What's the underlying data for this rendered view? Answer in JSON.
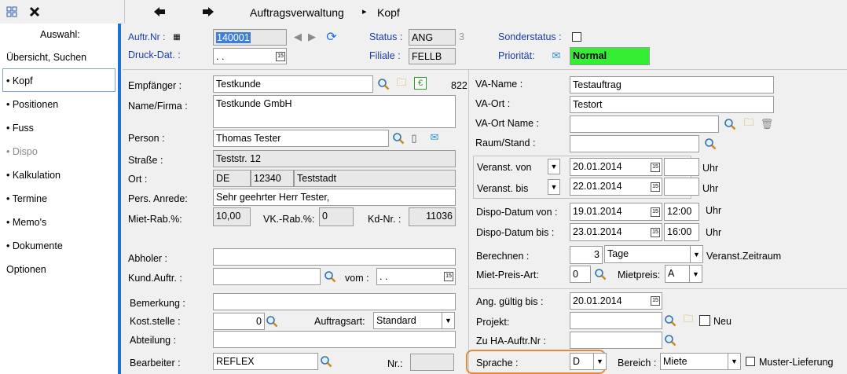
{
  "toolbar": {
    "grid_icon": "grid-icon",
    "close_icon": "close-icon",
    "back_icon": "arrow-left-icon",
    "forward_icon": "arrow-right-icon",
    "breadcrumb_root": "Auftragsverwaltung",
    "breadcrumb_sep": "▸",
    "breadcrumb_leaf": "Kopf"
  },
  "sidebar": {
    "title": "Auswahl:",
    "items": [
      {
        "label": "Übersicht, Suchen"
      },
      {
        "label": "• Kopf"
      },
      {
        "label": "• Positionen"
      },
      {
        "label": "• Fuss"
      },
      {
        "label": "• Dispo"
      },
      {
        "label": "• Kalkulation"
      },
      {
        "label": "• Termine"
      },
      {
        "label": "• Memo's"
      },
      {
        "label": "• Dokumente"
      },
      {
        "label": "Optionen"
      }
    ]
  },
  "header": {
    "auftr_nr_label": "Auftr.Nr :",
    "auftr_nr": "140001",
    "status_label": "Status :",
    "status": "ANG",
    "status_num": "3",
    "sonderstatus_label": "Sonderstatus :",
    "druck_dat_label": "Druck-Dat. :",
    "druck_dat": " .  .",
    "filiale_label": "Filiale :",
    "filiale": "FELLB",
    "prioritaet_label": "Priorität:",
    "prioritaet": "Normal"
  },
  "left": {
    "empfaenger_label": "Empfänger :",
    "empfaenger": "Testkunde",
    "empfaenger_num": "822",
    "name_label": "Name/Firma :",
    "name": "Testkunde GmbH",
    "person_label": "Person :",
    "person": "Thomas Tester",
    "strasse_label": "Straße :",
    "strasse": "Teststr. 12",
    "ort_label": "Ort :",
    "land": "DE",
    "plz": "12340",
    "ort": "Teststadt",
    "anrede_label": "Pers. Anrede:",
    "anrede": "Sehr geehrter Herr Tester,",
    "mietrab_label": "Miet-Rab.%:",
    "mietrab": "10,00",
    "vkrab_label": "VK.-Rab.%:",
    "vkrab": "0",
    "kdnr_label": "Kd-Nr. :",
    "kdnr": "11036",
    "abholer_label": "Abholer :",
    "abholer": "",
    "kundauftr_label": "Kund.Auftr. :",
    "kundauftr": "",
    "vom_label": "vom :",
    "vom": " .  .",
    "bemerkung_label": "Bemerkung :",
    "bemerkung": "",
    "koststelle_label": "Kost.stelle :",
    "koststelle": "0",
    "auftragsart_label": "Auftragsart:",
    "auftragsart": "Standard",
    "abteilung_label": "Abteilung :",
    "abteilung": "",
    "bearbeiter_label": "Bearbeiter :",
    "bearbeiter": "REFLEX",
    "nr_label": "Nr.:",
    "nr": ""
  },
  "right": {
    "vaname_label": "VA-Name :",
    "vaname": "Testauftrag",
    "vaort_label": "VA-Ort :",
    "vaort": "Testort",
    "vaortname_label": "VA-Ort Name :",
    "vaortname": "",
    "raum_label": "Raum/Stand :",
    "raum": "",
    "veranst_von_label": "Veranst. von",
    "veranst_von": "20.01.2014",
    "veranst_bis_label": "Veranst. bis",
    "veranst_bis": "22.01.2014",
    "uhr": "Uhr",
    "dispo_von_label": "Dispo-Datum von :",
    "dispo_von": "19.01.2014",
    "dispo_von_uhr": "12:00",
    "dispo_bis_label": "Dispo-Datum bis :",
    "dispo_bis": "23.01.2014",
    "dispo_bis_uhr": "16:00",
    "berechnen_label": "Berechnen :",
    "berechnen_num": "3",
    "berechnen_unit": "Tage",
    "veranst_zeitraum": "Veranst.Zeitraum",
    "mietpreisart_label": "Miet-Preis-Art:",
    "mietpreisart": "0",
    "mietpreis_label": "Mietpreis:",
    "mietpreis": "A",
    "ang_gueltig_label": "Ang. gültig bis :",
    "ang_gueltig": "20.01.2014",
    "projekt_label": "Projekt:",
    "projekt": "",
    "neu_label": "Neu",
    "zu_ha_label": "Zu HA-Auftr.Nr :",
    "zu_ha": "",
    "sprache_label": "Sprache :",
    "sprache": "D",
    "bereich_label": "Bereich :",
    "bereich": "Miete",
    "muster_label": "Muster-Lieferung"
  },
  "colors": {
    "accent": "#1e6fd9",
    "priority_bg": "#33ee33",
    "highlight_orange": "#e8883a",
    "selected_bg": "#3d7fd6"
  }
}
